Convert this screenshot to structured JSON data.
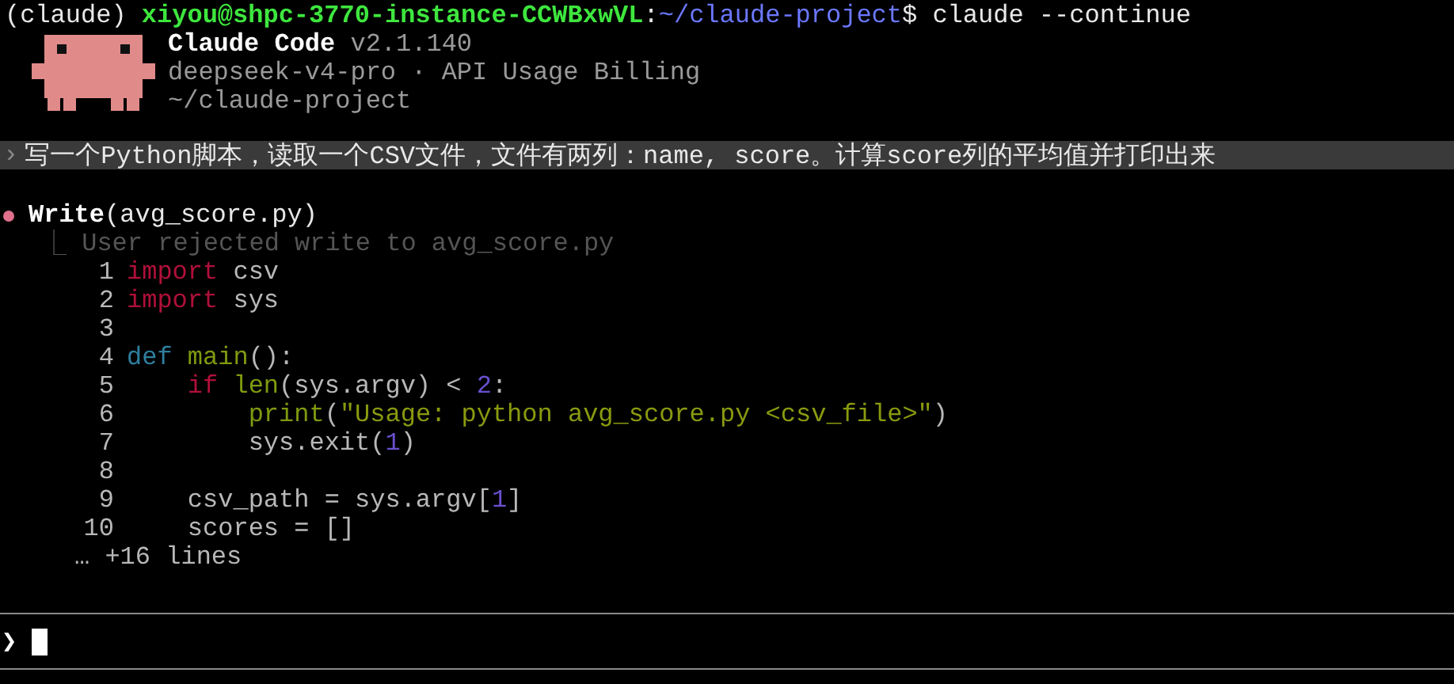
{
  "shell_prompt": [
    {
      "kind": "env",
      "text": "(claude)"
    },
    {
      "kind": "user_host",
      "text": "xiyou@shpc-3770-instance-CCWBxwVL"
    },
    {
      "kind": "separator",
      "text": ":"
    },
    {
      "kind": "path",
      "text": "~/claude-project"
    },
    {
      "kind": "command",
      "text": "$ claude --continue"
    }
  ],
  "banner": {
    "product": "Claude Code",
    "version": "v2.1.140",
    "model_line": "deepseek-v4-pro · API Usage Billing",
    "cwd": "~/claude-project"
  },
  "user_message": {
    "marker": "›",
    "text": "写一个Python脚本，读取一个CSV文件，文件有两列：name, score。计算score列的平均值并打印出来"
  },
  "tool_call": {
    "tool": "Write",
    "argument": "(avg_score.py)",
    "rejected": true,
    "branch": "⎿",
    "result": "User rejected write to avg_score.py"
  },
  "code_lines": [
    {
      "number": "1",
      "tokens": [
        {
          "kind": "keyword",
          "text": "import"
        },
        {
          "kind": "plain",
          "text": " csv"
        }
      ]
    },
    {
      "number": "2",
      "tokens": [
        {
          "kind": "keyword",
          "text": "import"
        },
        {
          "kind": "plain",
          "text": " sys"
        }
      ]
    },
    {
      "number": "3"
    },
    {
      "number": "4",
      "tokens": [
        {
          "kind": "def",
          "text": "def"
        },
        {
          "kind": "function",
          "text": " main"
        },
        {
          "kind": "plain",
          "text": "():"
        }
      ]
    },
    {
      "number": "5",
      "tokens": [
        {
          "kind": "keyword",
          "text": "    if"
        },
        {
          "kind": "function",
          "text": " len"
        },
        {
          "kind": "plain",
          "text": "(sys.argv) < "
        },
        {
          "kind": "number",
          "text": "2"
        },
        {
          "kind": "plain",
          "text": ":"
        }
      ]
    },
    {
      "number": "6",
      "tokens": [
        {
          "kind": "function",
          "text": "        print"
        },
        {
          "kind": "plain",
          "text": "("
        },
        {
          "kind": "string",
          "text": "\"Usage: python avg_score.py <csv_file>\""
        },
        {
          "kind": "plain",
          "text": ")"
        }
      ]
    },
    {
      "number": "7",
      "tokens": [
        {
          "kind": "plain",
          "text": "        sys.exit("
        },
        {
          "kind": "number",
          "text": "1"
        },
        {
          "kind": "plain",
          "text": ")"
        }
      ]
    },
    {
      "number": "8"
    },
    {
      "number": "9",
      "tokens": [
        {
          "kind": "plain",
          "text": "    csv_path = sys.argv["
        },
        {
          "kind": "number",
          "text": "1"
        },
        {
          "kind": "plain",
          "text": "]"
        }
      ]
    },
    {
      "number": "10",
      "tokens": [
        {
          "kind": "plain",
          "text": "    scores = []"
        }
      ]
    }
  ],
  "more_lines": "… +16 lines",
  "input": {
    "marker": "❯"
  }
}
